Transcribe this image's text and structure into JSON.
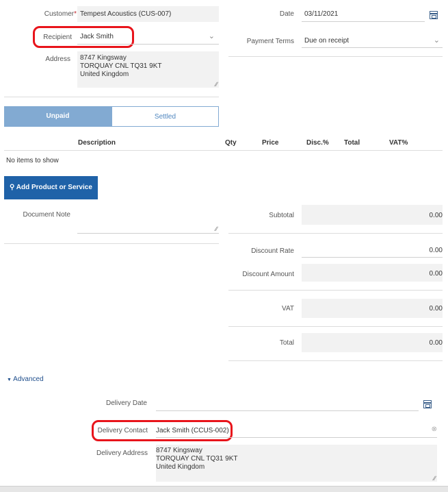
{
  "header": {
    "customer_label": "Customer",
    "required_mark": "*",
    "customer_value": "Tempest Acoustics (CUS-007)",
    "date_label": "Date",
    "date_value": "03/11/2021",
    "recipient_label": "Recipient",
    "recipient_value": "Jack Smith",
    "payment_terms_label": "Payment Terms",
    "payment_terms_value": "Due on receipt",
    "address_label": "Address",
    "address_lines": [
      "8747 Kingsway",
      "TORQUAY CNL TQ31 9KT",
      "United Kingdom"
    ]
  },
  "status_tabs": [
    {
      "label": "Unpaid",
      "active": true
    },
    {
      "label": "Settled",
      "active": false
    }
  ],
  "items_table": {
    "columns": [
      "Description",
      "Qty",
      "Price",
      "Disc.%",
      "Total",
      "VAT%"
    ],
    "empty_text": "No items to show"
  },
  "add_button": {
    "label": "Add Product or Service"
  },
  "note": {
    "label": "Document Note"
  },
  "totals": [
    {
      "label": "Subtotal",
      "value": "0.00"
    },
    {
      "label": "Discount Rate",
      "value": "0.00"
    },
    {
      "label": "Discount Amount",
      "value": "0.00"
    },
    {
      "label": "VAT",
      "value": "0.00"
    },
    {
      "label": "Total",
      "value": "0.00"
    }
  ],
  "advanced": {
    "toggle_label": "Advanced",
    "delivery_date_label": "Delivery Date",
    "delivery_date_value": "",
    "delivery_contact_label": "Delivery Contact",
    "delivery_contact_value": "Jack Smith (CCUS-002)",
    "delivery_address_label": "Delivery Address",
    "delivery_address_lines": [
      "8747 Kingsway",
      "TORQUAY CNL TQ31 9KT",
      "United Kingdom"
    ]
  },
  "icons": {
    "calendar": "calendar-icon",
    "chevron": "chevron-down-icon",
    "clear": "clear-icon",
    "search": "search-icon",
    "caret": "caret-down-icon"
  },
  "colors": {
    "highlight": "#e8141b",
    "primary": "#1f62a8",
    "tab_active": "#82aad2",
    "required": "#c0262d"
  }
}
